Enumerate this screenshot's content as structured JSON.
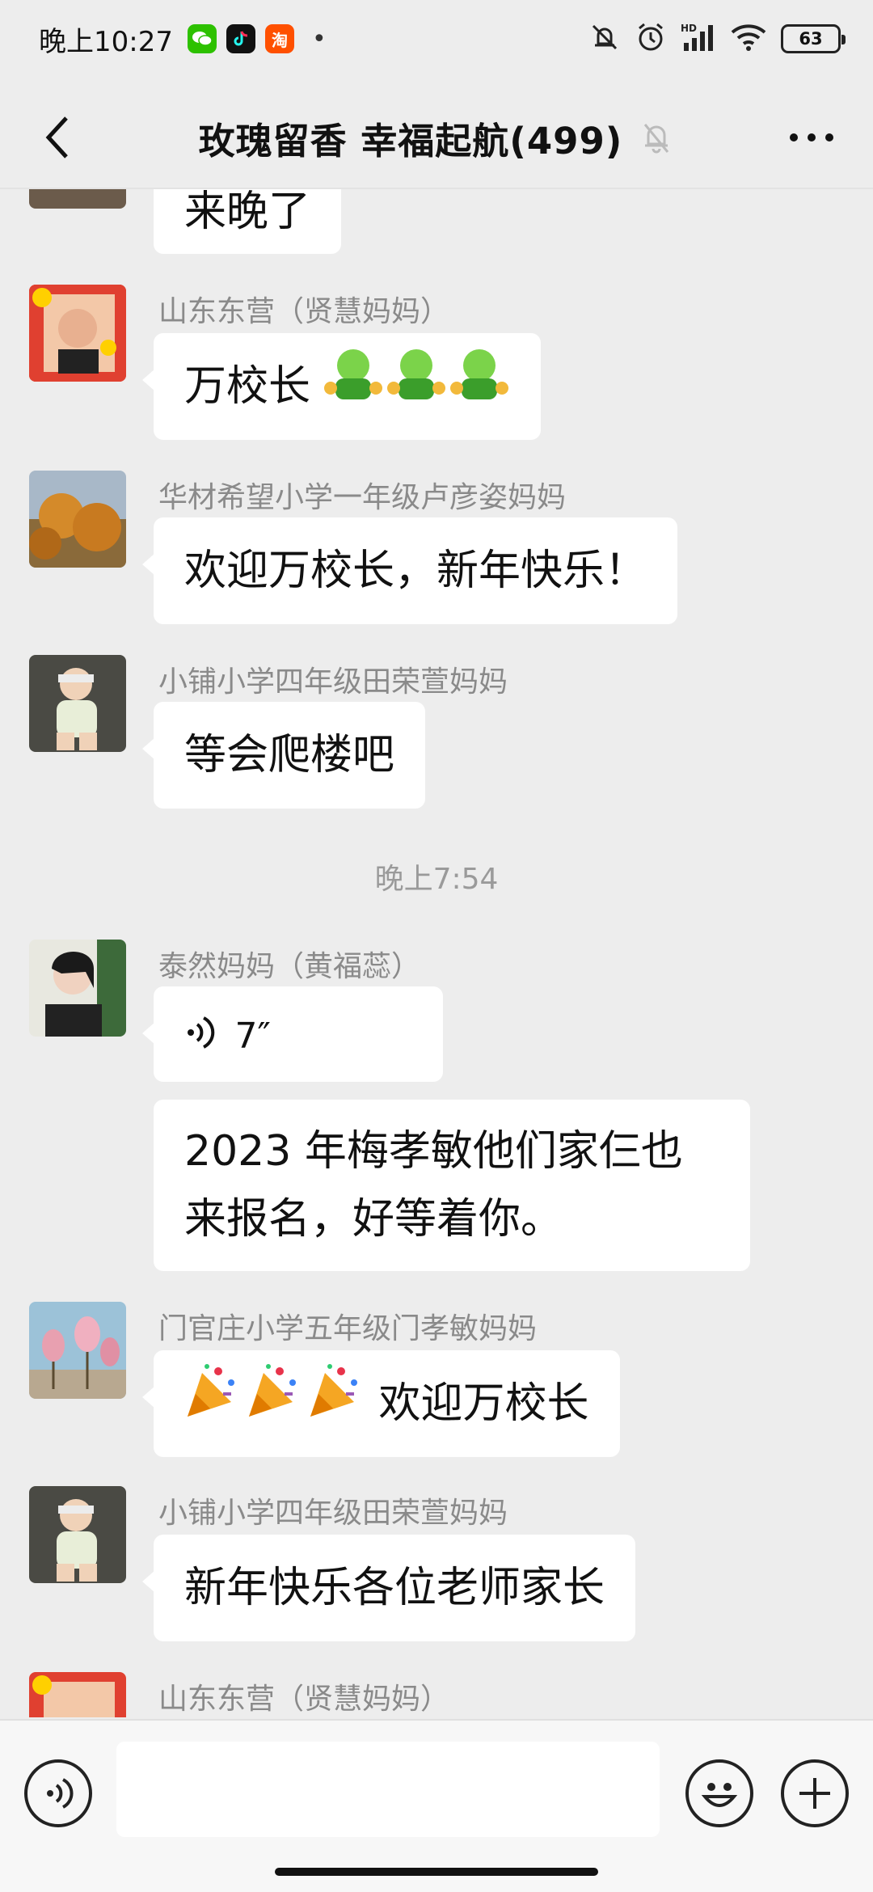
{
  "status_bar": {
    "time": "晚上10:27",
    "apps": [
      "wechat-icon",
      "tiktok-icon",
      "taobao-icon"
    ],
    "battery": "63",
    "taobao_glyph": "淘",
    "dot": "•",
    "hd_label": "HD"
  },
  "header": {
    "title": "玫瑰留香 幸福起航(499)"
  },
  "chat": {
    "top_partial_message": "来晚了",
    "messages": [
      {
        "sender": "山东东营（贤慧妈妈）",
        "text": "万校长"
      },
      {
        "sender": "华材希望小学一年级卢彦姿妈妈",
        "text": "欢迎万校长，新年快乐！"
      },
      {
        "sender": "小铺小学四年级田荣萱妈妈",
        "text": "等会爬楼吧"
      },
      {
        "sender": "泰然妈妈（黄福蕊）",
        "voice_duration": "7″",
        "text": "2023年梅孝敏他们家仨也来报名，好等着你。",
        "text_line1": "2023 年梅孝敏他们家仨也",
        "text_line2": "来报名，好等着你。"
      },
      {
        "sender": "门官庄小学五年级门孝敏妈妈",
        "text": "欢迎万校长"
      },
      {
        "sender": "小铺小学四年级田荣萱妈妈",
        "text": "新年快乐各位老师家长"
      },
      {
        "sender": "山东东营（贤慧妈妈）"
      }
    ],
    "time_separator": "晚上7:54"
  },
  "input_bar": {
    "placeholder": ""
  },
  "colors": {
    "background": "#ededed",
    "bubble": "#ffffff",
    "sender_text": "#8a8a8a",
    "wechat_green": "#2dc100"
  }
}
